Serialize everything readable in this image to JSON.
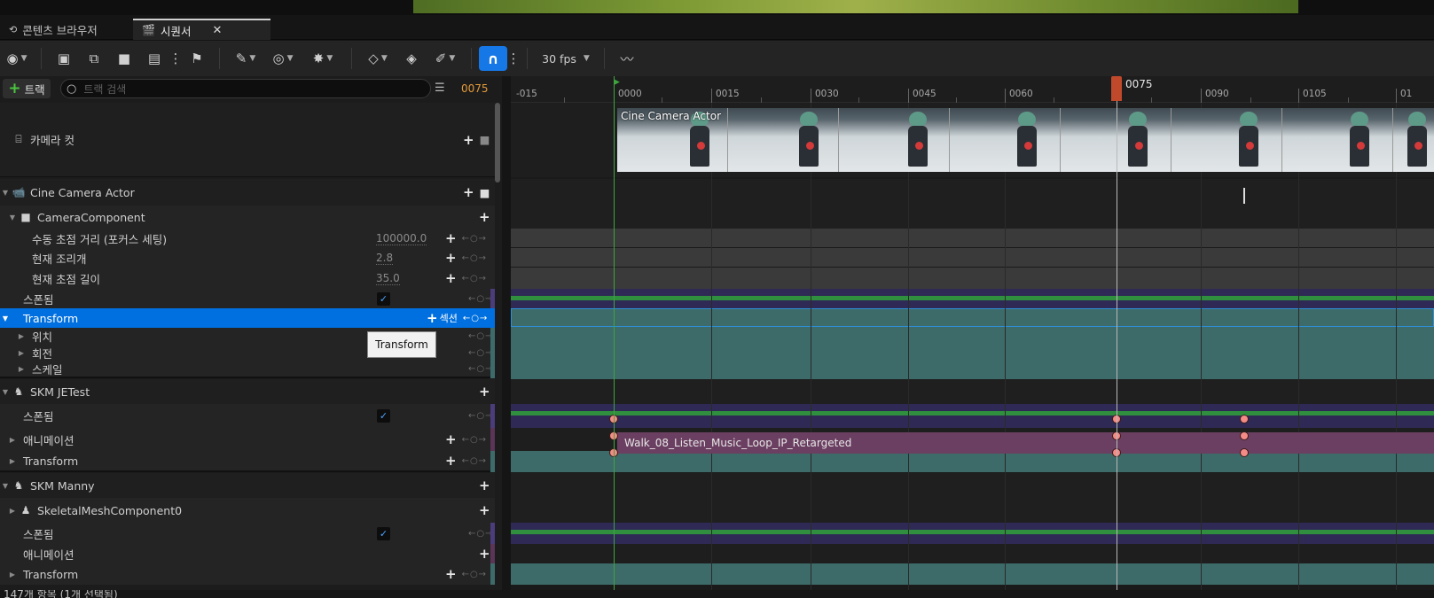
{
  "tabs": [
    {
      "label": "콘텐츠 브라우저",
      "active": false
    },
    {
      "label": "시퀀서",
      "active": true
    }
  ],
  "toolbar": {
    "fps_label": "30 fps"
  },
  "trackbar": {
    "add_track_label": "트랙",
    "search_placeholder": "트랙 검색",
    "current_frame": "0075"
  },
  "ruler": {
    "ticks": [
      "-015",
      "0000",
      "0015",
      "0030",
      "0045",
      "0060",
      "0075",
      "0090",
      "0105",
      "01"
    ],
    "playhead_label": "0075"
  },
  "tracks": {
    "camera_cut": "카메라 컷",
    "cine_camera": "Cine Camera Actor",
    "camera_component": "CameraComponent",
    "focus_distance": {
      "label": "수동 초점 거리 (포커스 세팅)",
      "value": "100000.0"
    },
    "aperture": {
      "label": "현재 조리개",
      "value": "2.8"
    },
    "focal_length": {
      "label": "현재 초점 길이",
      "value": "35.0"
    },
    "spawned": "스폰됨",
    "transform": "Transform",
    "section_label": "섹션",
    "location": "위치",
    "rotation": "회전",
    "scale": "스케일",
    "skm_jetest": "SKM JETest",
    "jetest_spawned": "스폰됨",
    "jetest_animation": "애니메이션",
    "jetest_transform": "Transform",
    "skm_manny": "SKM Manny",
    "skeletal_mesh": "SkeletalMeshComponent0",
    "manny_spawned": "스폰됨",
    "manny_animation": "애니메이션",
    "manny_transform": "Transform"
  },
  "tooltip": "Transform",
  "clips": {
    "camera_clip": "Cine Camera Actor",
    "anim_clip": "Walk_08_Listen_Music_Loop_IP_Retargeted"
  },
  "status": "147개 항목 (1개 선택됨)",
  "colors": {
    "accent": "#0070e0",
    "playhead": "#c0492c",
    "transform_track": "#3d6b69",
    "anim_clip": "#6b3f61",
    "spawn_bar": "#2f8f3e"
  }
}
